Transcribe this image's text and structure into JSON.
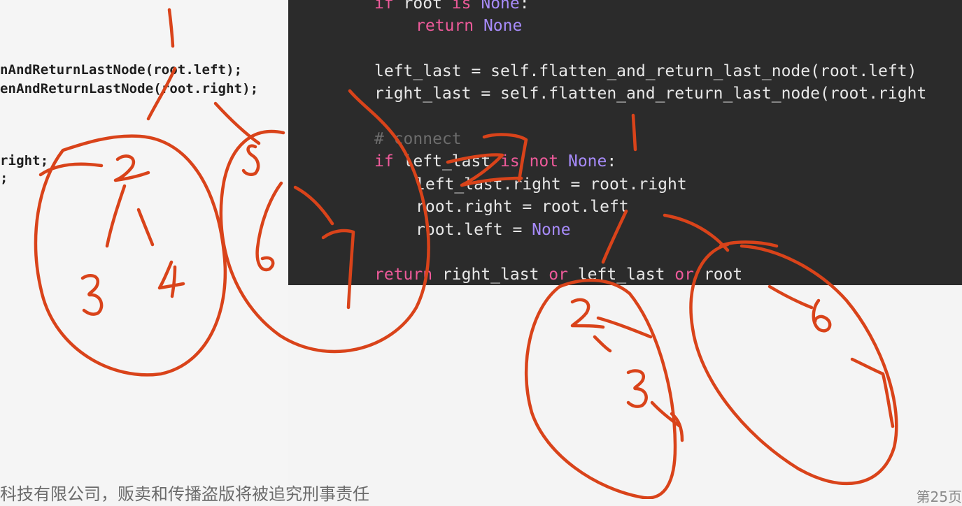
{
  "left_code": {
    "lines": [
      "nAndReturnLastNode(root.left);",
      "enAndReturnLastNode(root.right);",
      "right;",
      ";"
    ]
  },
  "editor": {
    "lines": [
      {
        "segs": [
          {
            "t": "if",
            "c": "kw"
          },
          {
            "t": " root ",
            "c": ""
          },
          {
            "t": "is",
            "c": "kw"
          },
          {
            "t": " ",
            "c": ""
          },
          {
            "t": "None",
            "c": "nn"
          },
          {
            "t": ":",
            "c": ""
          }
        ]
      },
      {
        "segs": [
          {
            "t": "return",
            "c": "kw"
          },
          {
            "t": " ",
            "c": ""
          },
          {
            "t": "None",
            "c": "nn"
          }
        ]
      },
      {
        "segs": [
          {
            "t": "left_last = self.flatten_and_return_last_node(root.left)",
            "c": ""
          }
        ]
      },
      {
        "segs": [
          {
            "t": "right_last = self.flatten_and_return_last_node(root.right",
            "c": ""
          }
        ]
      },
      {
        "segs": [
          {
            "t": "# connect",
            "c": "cm"
          }
        ]
      },
      {
        "segs": [
          {
            "t": "if",
            "c": "kw"
          },
          {
            "t": " left_last ",
            "c": ""
          },
          {
            "t": "is not",
            "c": "kw"
          },
          {
            "t": " ",
            "c": ""
          },
          {
            "t": "None",
            "c": "nn"
          },
          {
            "t": ":",
            "c": ""
          }
        ]
      },
      {
        "segs": [
          {
            "t": "left_last.right = root.right",
            "c": ""
          }
        ]
      },
      {
        "segs": [
          {
            "t": "root.right = root.left",
            "c": ""
          }
        ]
      },
      {
        "segs": [
          {
            "t": "root.left = ",
            "c": ""
          },
          {
            "t": "None",
            "c": "nn"
          }
        ]
      },
      {
        "segs": [
          {
            "t": "return",
            "c": "kw"
          },
          {
            "t": " right_last ",
            "c": ""
          },
          {
            "t": "or",
            "c": "kw"
          },
          {
            "t": " left_last ",
            "c": ""
          },
          {
            "t": "or",
            "c": "kw"
          },
          {
            "t": " root",
            "c": ""
          }
        ]
      }
    ]
  },
  "footer": {
    "text": "科技有限公司，贩卖和传播盗版将被追究刑事责任",
    "page": "第25页"
  },
  "annotations": {
    "ink_color": "#d9431a",
    "labels": [
      "1",
      "2",
      "3",
      "4",
      "5",
      "6",
      "7",
      "1",
      "2",
      "3",
      "4",
      "6",
      "7"
    ]
  }
}
